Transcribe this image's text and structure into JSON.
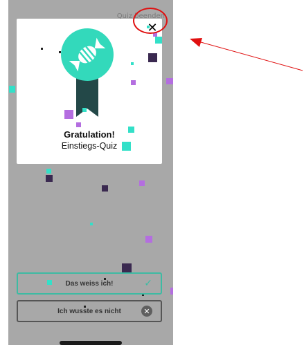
{
  "header": {
    "quit_label": "Quiz beenden"
  },
  "modal": {
    "title": "Gratulation!",
    "subtitle": "Einstiegs-Quiz",
    "close_symbol": "✕",
    "badge_icon": "candy-medal-icon"
  },
  "answers": {
    "know_label": "Das weiss ich!",
    "know_icon": "check-icon",
    "know_symbol": "✓",
    "notknow_label": "Ich wusste es nicht",
    "notknow_icon": "x-circle-icon",
    "notknow_symbol": "✕"
  },
  "colors": {
    "accent_teal": "#3dbba3",
    "badge_teal": "#33d9bb",
    "ribbon_dark": "#234848",
    "annotation_red": "#e01010"
  }
}
